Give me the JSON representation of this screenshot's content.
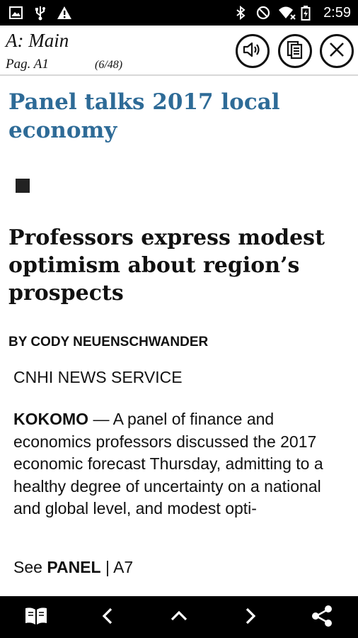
{
  "status_bar": {
    "time": "2:59",
    "icons_left": [
      "image-icon",
      "usb-icon",
      "warning-icon"
    ],
    "icons_right": [
      "bluetooth-icon",
      "do-not-disturb-icon",
      "wifi-icon",
      "battery-icon"
    ]
  },
  "header": {
    "section": "A: Main",
    "page": "Pag. A1",
    "page_count": "(6/48)",
    "buttons": [
      "speaker-icon",
      "copy-icon",
      "close-icon"
    ]
  },
  "article": {
    "headline": "Panel talks 2017 local economy",
    "subhead": "Professors express modest optimism about region’s prospects",
    "byline": "BY CODY NEUENSCHWANDER",
    "service": "CNHI NEWS SERVICE",
    "dateline": "KOKOMO",
    "body": " — A panel of finance and economics professors discussed the 2017 economic forecast Thursday, admitting to a healthy degree of uncertainty on a national and global level, and modest opti-",
    "jump_prefix": "See ",
    "jump_keyword": "PANEL",
    "jump_page": " | A7"
  },
  "colors": {
    "headline": "#2e6b97",
    "status_bar": "#000000",
    "nav_bar": "#000000"
  },
  "bottom_nav": [
    "book-icon",
    "previous-icon",
    "up-icon",
    "next-icon",
    "share-icon"
  ]
}
